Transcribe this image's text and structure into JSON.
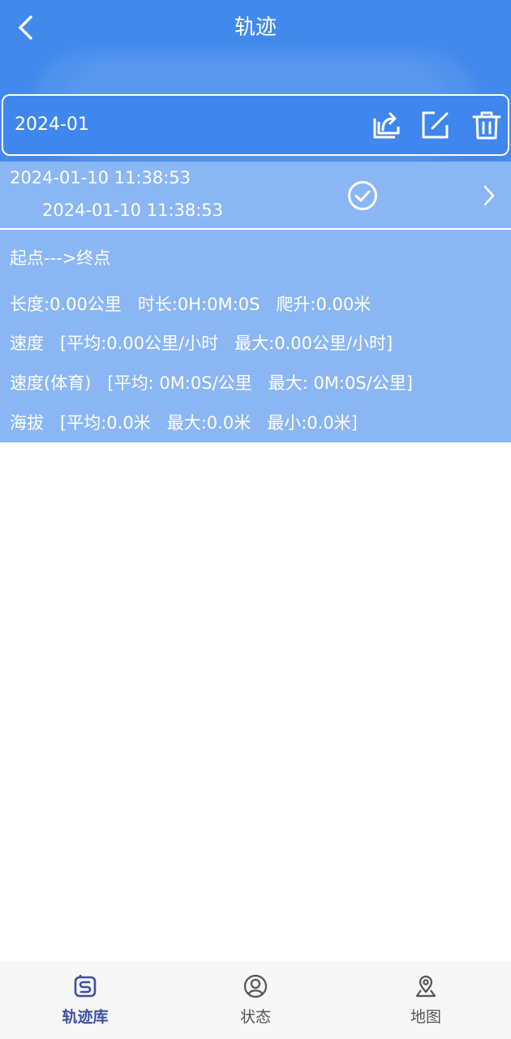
{
  "header": {
    "title": "轨迹",
    "back_icon": "chevron-left-icon"
  },
  "month_bar": {
    "label": "2024-01",
    "actions": [
      {
        "icon": "export-icon"
      },
      {
        "icon": "edit-icon"
      },
      {
        "icon": "trash-icon"
      }
    ]
  },
  "track": {
    "start_time": "2024-01-10 11:38:53",
    "end_time": "2024-01-10 11:38:53",
    "selected_icon": "check-circle-icon",
    "open_icon": "chevron-right-icon",
    "route": "起点--->终点",
    "stats": "长度:0.00公里   时长:0H:0M:0S   爬升:0.00米",
    "speed": "速度   [平均:0.00公里/小时   最大:0.00公里/小时]",
    "pace": "速度(体育)   [平均: 0M:0S/公里   最大: 0M:0S/公里]",
    "altitude": "海拔   [平均:0.0米   最大:0.0米   最小:0.0米]"
  },
  "bottom_nav": {
    "items": [
      {
        "label": "轨迹库",
        "icon": "track-library-icon",
        "active": true
      },
      {
        "label": "状态",
        "icon": "person-circle-icon",
        "active": false
      },
      {
        "label": "地图",
        "icon": "map-pin-icon",
        "active": false
      }
    ]
  },
  "colors": {
    "header_bg": "#4289ec",
    "row_bg": "#8ab6f4",
    "nav_active": "#3c4fa3",
    "nav_inactive": "#555555"
  }
}
